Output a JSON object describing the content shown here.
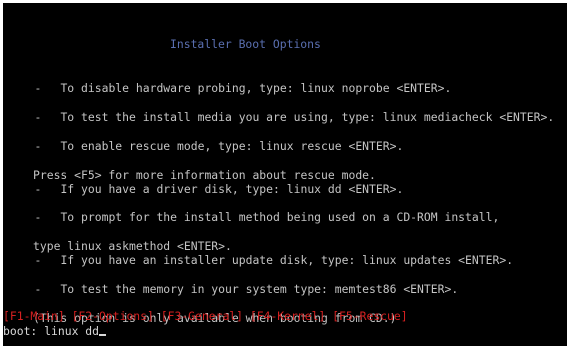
{
  "screen": {
    "title": "Installer Boot Options",
    "options": [
      {
        "dash": "-",
        "lines": [
          "To disable hardware probing, type: linux noprobe <ENTER>."
        ]
      },
      {
        "dash": "-",
        "lines": [
          "To test the install media you are using, type: linux mediacheck <ENTER>."
        ]
      },
      {
        "dash": "-",
        "lines": [
          "To enable rescue mode, type: linux rescue <ENTER>.",
          "Press <F5> for more information about rescue mode."
        ]
      },
      {
        "dash": "-",
        "lines": [
          "If you have a driver disk, type: linux dd <ENTER>."
        ]
      },
      {
        "dash": "-",
        "lines": [
          "To prompt for the install method being used on a CD-ROM install,",
          "type linux askmethod <ENTER>."
        ]
      },
      {
        "dash": "-",
        "lines": [
          "If you have an installer update disk, type: linux updates <ENTER>."
        ]
      },
      {
        "dash": "-",
        "lines": [
          "To test the memory in your system type: memtest86 <ENTER>.",
          "(This option is only available when booting from CD.)"
        ]
      }
    ],
    "function_keys": "[F1-Main] [F2-Options] [F3-General] [F4-Kernel] [F5-Rescue]",
    "prompt_label": "boot:",
    "prompt_value": "linux dd"
  }
}
